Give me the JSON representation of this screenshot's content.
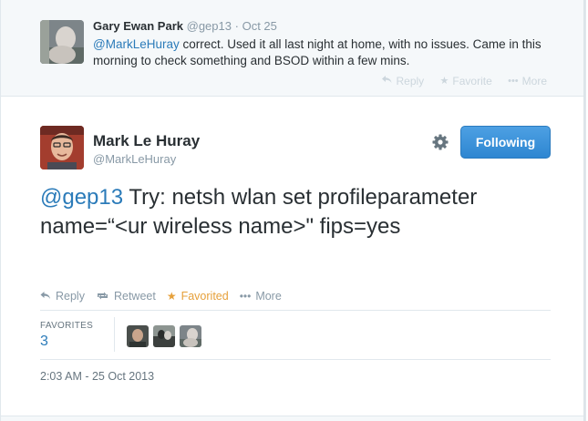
{
  "parent_tweet": {
    "name": "Gary Ewan Park",
    "handle": "@gep13",
    "separator": "·",
    "time": "Oct 25",
    "mention": "@MarkLeHuray",
    "text": " correct. Used it all last night at home, with no issues. Came in this morning to check something and BSOD within a few mins.",
    "actions": {
      "reply": "Reply",
      "favorite": "Favorite",
      "more": "More"
    }
  },
  "main_tweet": {
    "name": "Mark Le Huray",
    "handle": "@MarkLeHuray",
    "follow_button": "Following",
    "mention": "@gep13",
    "text": " Try: netsh wlan set profileparameter name=“<ur wireless name>\" fips=yes",
    "actions": {
      "reply": "Reply",
      "retweet": "Retweet",
      "favorited": "Favorited",
      "more": "More"
    },
    "stats": {
      "favorites_label": "FAVORITES",
      "favorites_count": "3"
    },
    "timestamp": "2:03 AM - 25 Oct 2013"
  },
  "colors": {
    "link": "#2b7bb9",
    "follow_button": "#3a8fd8",
    "favorited": "#e6a03a",
    "muted": "#8899a6"
  }
}
